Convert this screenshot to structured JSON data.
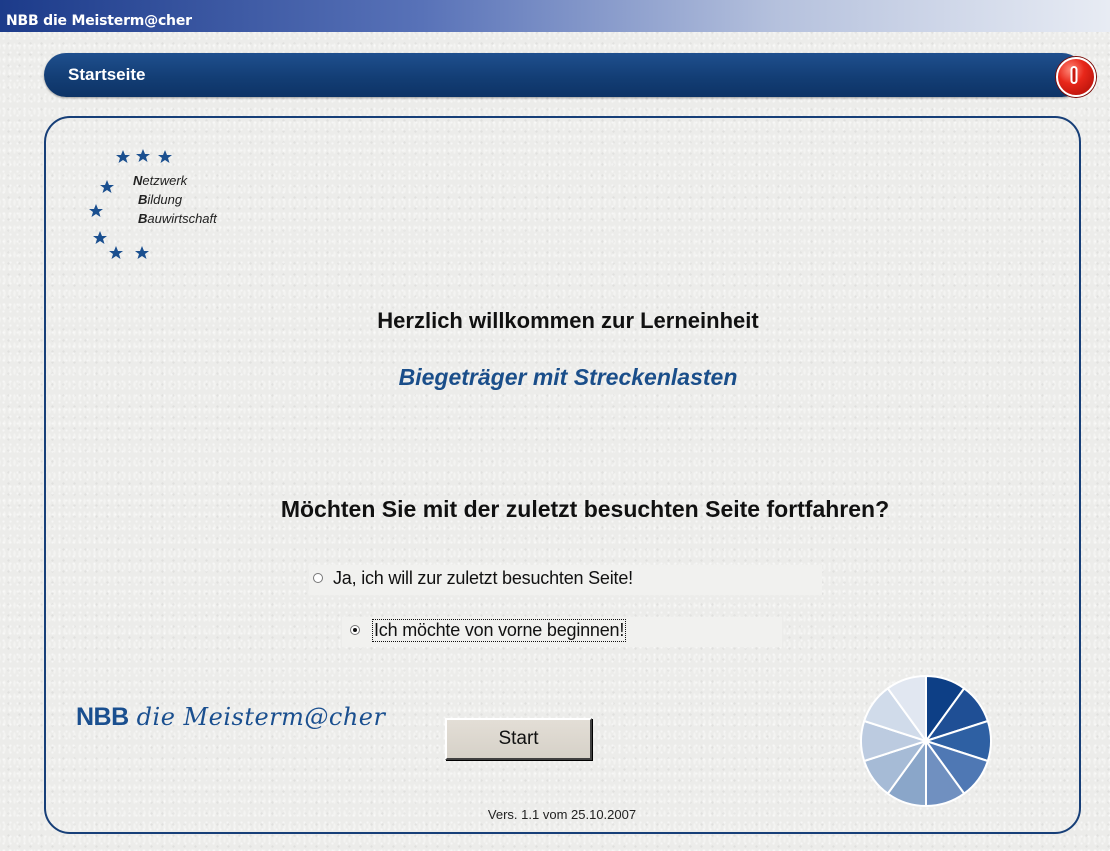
{
  "window": {
    "title": "NBB die Meisterm@cher"
  },
  "header": {
    "title": "Startseite",
    "close_icon": "power-icon"
  },
  "logo": {
    "line1_initial": "N",
    "line1_rest": "etzwerk",
    "line2_initial": "B",
    "line2_rest": "ildung",
    "line3_initial": "B",
    "line3_rest": "auwirtschaft"
  },
  "main": {
    "welcome": "Herzlich willkommen zur Lerneinheit",
    "course_title": "Biegeträger mit Streckenlasten",
    "question": "Möchten Sie mit der zuletzt besuchten Seite fortfahren?",
    "options": [
      {
        "label": "Ja, ich will zur zuletzt besuchten Seite!",
        "selected": false
      },
      {
        "label": "Ich möchte von vorne beginnen!",
        "selected": true
      }
    ],
    "start_label": "Start",
    "version": "Vers. 1.1 vom 25.10.2007"
  },
  "brand": {
    "nbb": "NBB",
    "script": "die Meisterm@cher"
  },
  "colors": {
    "accent": "#133e75",
    "course_title": "#1a4e8a",
    "power_button": "#e8271a"
  }
}
